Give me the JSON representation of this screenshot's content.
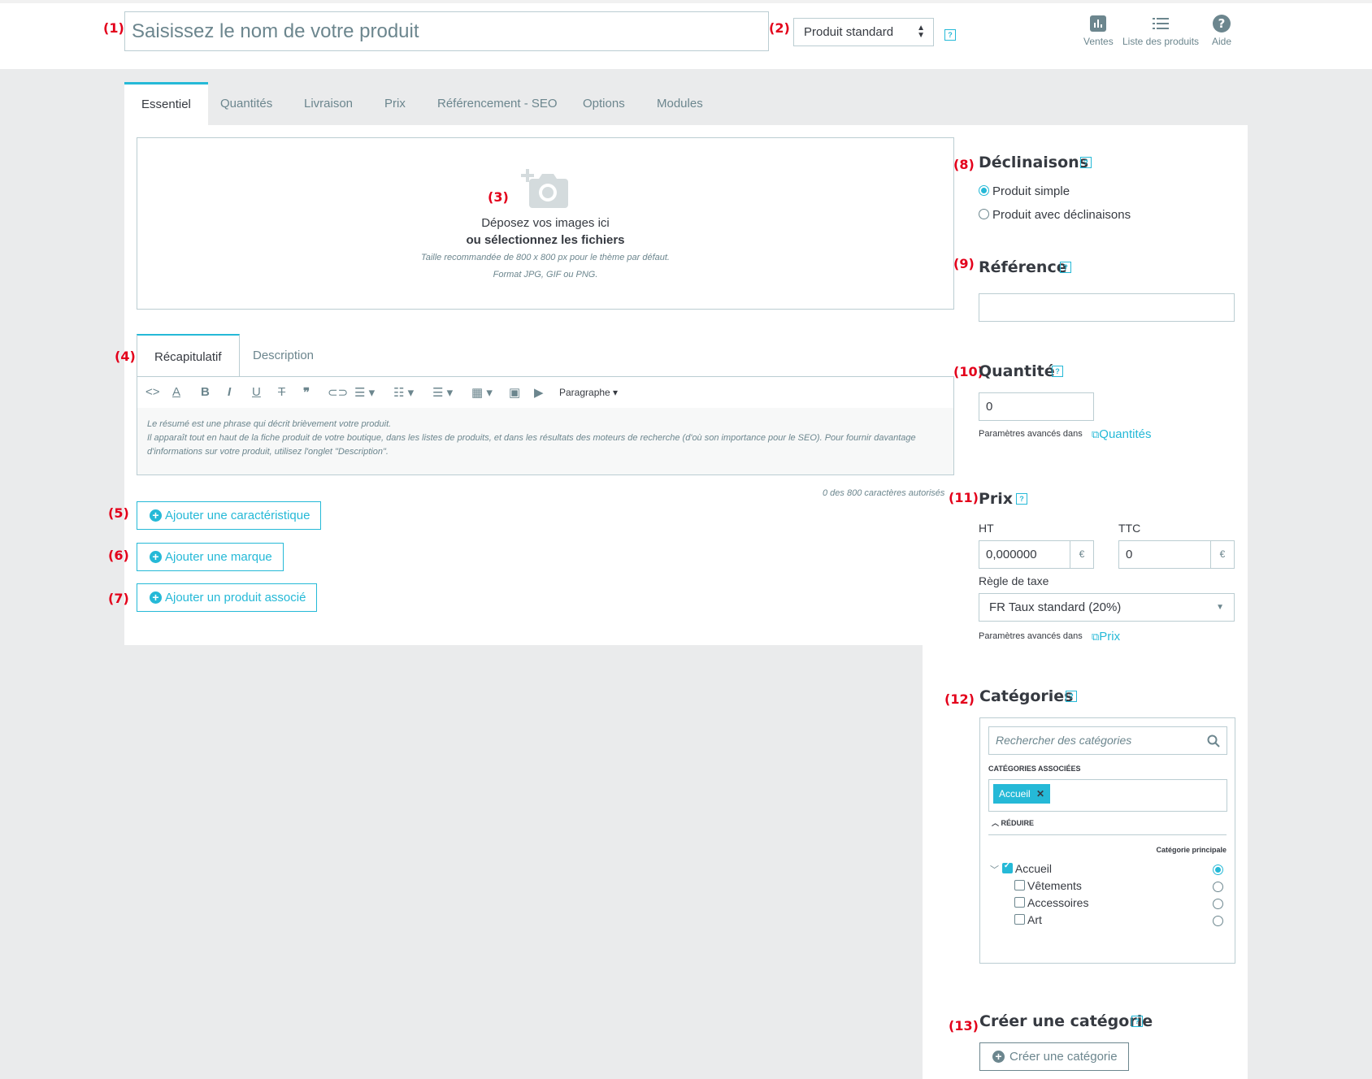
{
  "header": {
    "name_placeholder": "Saisissez le nom de votre produit",
    "product_type": "Produit standard",
    "actions": [
      {
        "label": "Ventes",
        "icon": "bar-chart-icon"
      },
      {
        "label": "Liste des produits",
        "icon": "list-icon"
      },
      {
        "label": "Aide",
        "icon": "help-circle-icon"
      }
    ]
  },
  "annotations": {
    "a1": "(1)",
    "a2": "(2)",
    "a3": "(3)",
    "a4": "(4)",
    "a5": "(5)",
    "a6": "(6)",
    "a7": "(7)",
    "a8": "(8)",
    "a9": "(9)",
    "a10": "(10)",
    "a11": "(11)",
    "a12": "(12)",
    "a13": "(13)"
  },
  "help_mark": "?",
  "tabs": [
    "Essentiel",
    "Quantités",
    "Livraison",
    "Prix",
    "Référencement - SEO",
    "Options",
    "Modules"
  ],
  "dropzone": {
    "line1": "Déposez vos images ici",
    "line2": "ou sélectionnez les fichiers",
    "line3": "Taille recommandée de 800 x 800 px pour le thème par défaut.",
    "line4": "Format JPG, GIF ou PNG."
  },
  "description_tabs": [
    "Récapitulatif",
    "Description"
  ],
  "editor": {
    "paragraph_label": "Paragraphe",
    "placeholder_line1": "Le résumé est une phrase qui décrit brièvement votre produit.",
    "placeholder_line2": "Il apparaît tout en haut de la fiche produit de votre boutique, dans les listes de produits, et dans les résultats des moteurs de recherche (d'où son importance pour le SEO). Pour fournir davantage d'informations sur votre produit, utilisez l'onglet \"Description\".",
    "counter": "0 des 800 caractères autorisés"
  },
  "buttons": {
    "add_feature": "Ajouter une caractéristique",
    "add_brand": "Ajouter une marque",
    "add_related": "Ajouter un produit associé",
    "create_category": "Créer une catégorie"
  },
  "declinaisons": {
    "title": "Déclinaisons",
    "option_simple": "Produit simple",
    "option_combinations": "Produit avec déclinaisons",
    "selected": "Produit simple"
  },
  "reference": {
    "title": "Référence",
    "value": ""
  },
  "quantity": {
    "title": "Quantité",
    "value": "0",
    "advanced_text": "Paramètres avancés dans",
    "advanced_link": "Quantités"
  },
  "price": {
    "title": "Prix",
    "ht_label": "HT",
    "ttc_label": "TTC",
    "ht_value": "0,000000",
    "ttc_value": "0",
    "currency": "€",
    "tax_label": "Règle de taxe",
    "tax_value": "FR Taux standard (20%)",
    "advanced_text": "Paramètres avancés dans",
    "advanced_link": "Prix"
  },
  "categories": {
    "title": "Catégories",
    "search_placeholder": "Rechercher des catégories",
    "associated_label": "CATÉGORIES ASSOCIÉES",
    "associated_tag": "Accueil",
    "collapse_label": "RÉDUIRE",
    "main_category_label": "Catégorie principale",
    "tree": [
      {
        "label": "Accueil",
        "checked": true,
        "main": true
      },
      {
        "label": "Vêtements",
        "checked": false,
        "main": false
      },
      {
        "label": "Accessoires",
        "checked": false,
        "main": false
      },
      {
        "label": "Art",
        "checked": false,
        "main": false
      }
    ]
  },
  "create_category": {
    "title": "Créer une catégorie"
  },
  "colors": {
    "accent": "#25b9d7",
    "annotation": "#e3001b",
    "text": "#363a41",
    "muted": "#6c868e"
  }
}
